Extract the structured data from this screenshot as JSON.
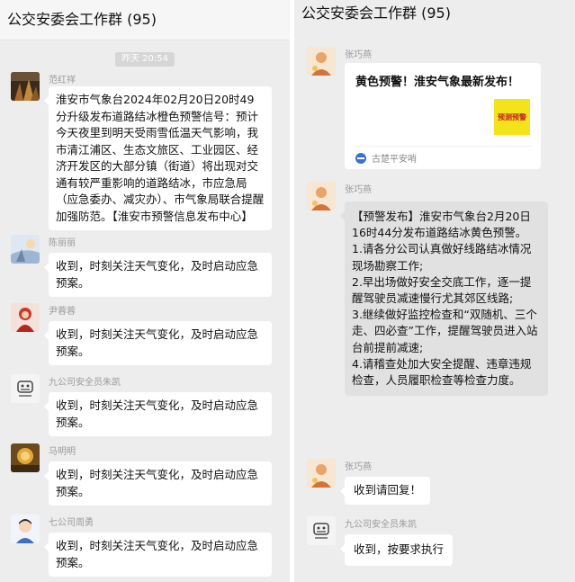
{
  "left": {
    "title": "公交安委会工作群 (95)",
    "timestamp": "昨天 20:54",
    "messages": [
      {
        "name": "范红祥",
        "text": "淮安市气象台2024年02月20日20时49分升级发布道路结冰橙色预警信号：预计今天夜里到明天受雨雪低温天气影响，我市清江浦区、生态文旅区、工业园区、经济开发区的大部分镇（街道）将出现对交通有较严重影响的道路结冰，市应急局（应急委办、减灾办）、市气象局联合提醒加强防范。【淮安市预警信息发布中心】"
      },
      {
        "name": "陈丽丽",
        "text": "收到，时刻关注天气变化，及时启动应急预案。"
      },
      {
        "name": "尹蓉蓉",
        "text": "收到，时刻关注天气变化，及时启动应急预案。"
      },
      {
        "name": "九公司安全员朱凯",
        "text": "收到，时刻关注天气变化，及时启动应急预案。"
      },
      {
        "name": "马明明",
        "text": "收到，时刻关注天气变化，及时启动应急预案。"
      },
      {
        "name": "七公司周勇",
        "text": "收到，时刻关注天气变化，及时启动应急预案。"
      }
    ]
  },
  "right": {
    "title": "公交安委会工作群 (95)",
    "card": {
      "sender": "张巧燕",
      "title": "黄色预警！淮安气象最新发布！",
      "thumb_text": "预测预警",
      "source": "古楚平安哨"
    },
    "notice": {
      "sender": "张巧燕",
      "lines": [
        "【预警发布】淮安市气象台2月20日16时44分发布道路结冰黄色预警。",
        "1.请各分公司认真做好线路结冰情况现场勘察工作;",
        "2.早出场做好安全交底工作，逐一提醒驾驶员减速慢行尤其郊区线路;",
        "3.继续做好监控检查和“双随机、三个走、四必查”工作，提醒驾驶员进入站台前提前减速;",
        "4.请稽查处加大安全提醒、违章违规检查，人员履职检查等检查力度。"
      ]
    },
    "reply1": {
      "sender": "张巧燕",
      "text": "收到请回复！"
    },
    "reply2": {
      "sender": "九公司安全员朱凯",
      "text": "收到，按要求执行"
    }
  },
  "colors": {
    "chat_background": "#ededed",
    "bubble": "#ffffff",
    "notice_bubble": "#e1e1e1",
    "name_text": "#9a9a9a",
    "warning_yellow": "#f4e21a"
  }
}
